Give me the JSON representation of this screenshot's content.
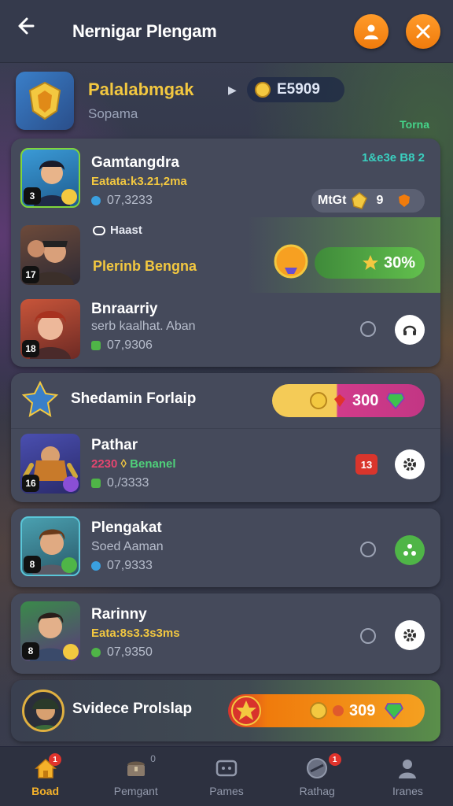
{
  "header": {
    "title": "Nernigar Plengam",
    "back_icon": "back-arrow-icon",
    "profile_icon": "profile-icon",
    "battle_icon": "crossed-swords-icon"
  },
  "banner": {
    "title": "Palalabmgak",
    "subtitle": "Sopama",
    "coin_value": "E5909",
    "right_label": "Torna"
  },
  "section1": {
    "rows": [
      {
        "name": "Gamtangdra",
        "stat": "Eatata:k3.21,2ma",
        "meta": "07,3233",
        "level": "3",
        "right_text": "1&e3e B8 2",
        "mod_label": "MtGt",
        "mod_value": "9"
      },
      {
        "name": "Haast",
        "label": "Plerinb Bengna",
        "level": "17",
        "percent": "30%"
      },
      {
        "name": "Bnraarriy",
        "stat": "serb kaalhat. Aban",
        "meta": "07,9306",
        "level": "18"
      }
    ]
  },
  "section2": {
    "title": "Shedamin Forlaip",
    "pill_value": "300",
    "row": {
      "name": "Pathar",
      "stat_a": "2230",
      "stat_b": "Benanel",
      "meta": "0,/3333",
      "level": "16",
      "tag": "13"
    }
  },
  "section3": {
    "name": "Plengakat",
    "stat": "Soed Aaman",
    "meta": "07,9333",
    "level": "8"
  },
  "section4": {
    "name": "Rarinny",
    "stat": "Eata:8s3.3s3ms",
    "meta": "07,9350",
    "level": "8"
  },
  "section5": {
    "title": "Svidece Prolslap",
    "pill_value": "309"
  },
  "tabs": [
    {
      "label": "Boad",
      "icon": "home-icon",
      "badge": "1",
      "active": true
    },
    {
      "label": "Pemgant",
      "icon": "chest-icon",
      "badge": "0",
      "active": false
    },
    {
      "label": "Pames",
      "icon": "gamepad-icon",
      "badge": "",
      "active": false
    },
    {
      "label": "Rathag",
      "icon": "globe-icon",
      "badge": "1",
      "active": false
    },
    {
      "label": "Iranes",
      "icon": "person-icon",
      "badge": "",
      "active": false
    }
  ],
  "colors": {
    "accent_orange": "#f07b0c",
    "gold": "#f3c840",
    "green": "#4fb547",
    "pink": "#d13b8a"
  }
}
